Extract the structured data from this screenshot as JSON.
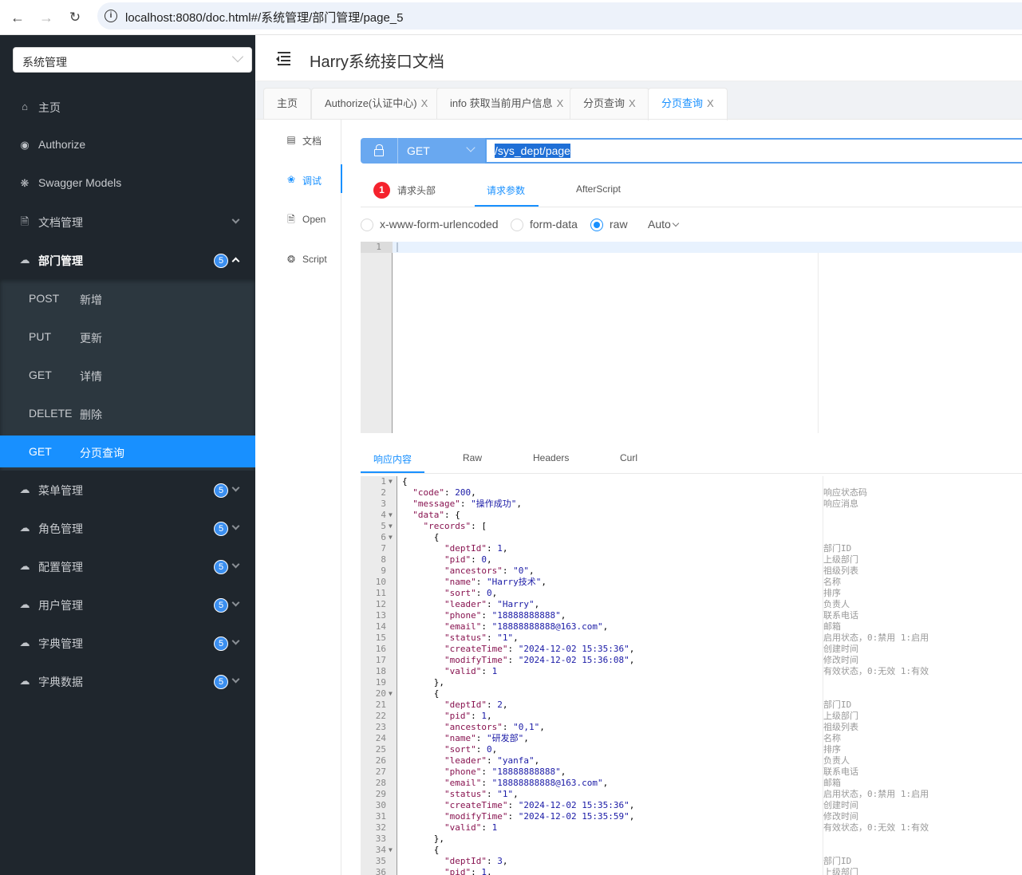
{
  "browser": {
    "url": "localhost:8080/doc.html#/系统管理/部门管理/page_5",
    "back_icon": "arrow-left-icon",
    "forward_icon": "arrow-right-icon",
    "reload_icon": "reload-icon"
  },
  "sidebar": {
    "group_select": "系统管理",
    "items": [
      {
        "label": "主页",
        "icon": "home-icon"
      },
      {
        "label": "Authorize",
        "icon": "lock-icon"
      },
      {
        "label": "Swagger Models",
        "icon": "cube-icon"
      },
      {
        "label": "文档管理",
        "icon": "doc-gear-icon"
      },
      {
        "label": "部门管理",
        "icon": "cloud-icon",
        "badge": "5"
      },
      {
        "label": "菜单管理",
        "icon": "cloud-icon",
        "badge": "5"
      },
      {
        "label": "角色管理",
        "icon": "cloud-icon",
        "badge": "5"
      },
      {
        "label": "配置管理",
        "icon": "cloud-icon",
        "badge": "5"
      },
      {
        "label": "用户管理",
        "icon": "cloud-icon",
        "badge": "5"
      },
      {
        "label": "字典管理",
        "icon": "cloud-icon",
        "badge": "5"
      },
      {
        "label": "字典数据",
        "icon": "cloud-icon",
        "badge": "5"
      }
    ],
    "submenu": [
      {
        "method": "POST",
        "name": "新增"
      },
      {
        "method": "PUT",
        "name": "更新"
      },
      {
        "method": "GET",
        "name": "详情"
      },
      {
        "method": "DELETE",
        "name": "删除"
      },
      {
        "method": "GET",
        "name": "分页查询"
      }
    ]
  },
  "header": {
    "title": "Harry系统接口文档"
  },
  "tabs": [
    {
      "label": "主页",
      "closable": false
    },
    {
      "label": "Authorize(认证中心)",
      "closable": true
    },
    {
      "label": "info 获取当前用户信息",
      "closable": true
    },
    {
      "label": "分页查询",
      "closable": true
    },
    {
      "label": "分页查询",
      "closable": true,
      "active": true
    }
  ],
  "close_glyph": "X",
  "subnav": [
    {
      "label": "文档",
      "icon": "document-icon"
    },
    {
      "label": "调试",
      "icon": "bug-icon"
    },
    {
      "label": "Open",
      "icon": "file-icon"
    },
    {
      "label": "Script",
      "icon": "script-icon"
    }
  ],
  "request": {
    "method": "GET",
    "url": "/sys_dept/page",
    "param_tabs": [
      "请求头部",
      "请求参数",
      "AfterScript"
    ],
    "header_error_count": "1",
    "body_types": [
      "x-www-form-urlencoded",
      "form-data",
      "raw"
    ],
    "selected_body_type": "raw",
    "raw_format": "Auto",
    "editor_line": "1"
  },
  "response": {
    "tabs": [
      "响应内容",
      "Raw",
      "Headers",
      "Curl"
    ],
    "lines": [
      {
        "n": "1",
        "fold": true,
        "code": "{",
        "cmt": ""
      },
      {
        "n": "2",
        "code": "  <k>\"code\"</k>: <n>200</n>,",
        "cmt": "响应状态码"
      },
      {
        "n": "3",
        "code": "  <k>\"message\"</k>: <s>\"操作成功\"</s>,",
        "cmt": "响应消息"
      },
      {
        "n": "4",
        "fold": true,
        "code": "  <k>\"data\"</k>: {",
        "cmt": ""
      },
      {
        "n": "5",
        "fold": true,
        "code": "    <k>\"records\"</k>: [",
        "cmt": ""
      },
      {
        "n": "6",
        "fold": true,
        "code": "      {",
        "cmt": ""
      },
      {
        "n": "7",
        "code": "        <k>\"deptId\"</k>: <n>1</n>,",
        "cmt": "部门ID"
      },
      {
        "n": "8",
        "code": "        <k>\"pid\"</k>: <n>0</n>,",
        "cmt": "上级部门"
      },
      {
        "n": "9",
        "code": "        <k>\"ancestors\"</k>: <s>\"0\"</s>,",
        "cmt": "祖级列表"
      },
      {
        "n": "10",
        "code": "        <k>\"name\"</k>: <s>\"Harry技术\"</s>,",
        "cmt": "名称"
      },
      {
        "n": "11",
        "code": "        <k>\"sort\"</k>: <n>0</n>,",
        "cmt": "排序"
      },
      {
        "n": "12",
        "code": "        <k>\"leader\"</k>: <s>\"Harry\"</s>,",
        "cmt": "负责人"
      },
      {
        "n": "13",
        "code": "        <k>\"phone\"</k>: <s>\"18888888888\"</s>,",
        "cmt": "联系电话"
      },
      {
        "n": "14",
        "code": "        <k>\"email\"</k>: <s>\"18888888888@163.com\"</s>,",
        "cmt": "邮箱"
      },
      {
        "n": "15",
        "code": "        <k>\"status\"</k>: <s>\"1\"</s>,",
        "cmt": "启用状态，0:禁用 1:启用"
      },
      {
        "n": "16",
        "code": "        <k>\"createTime\"</k>: <s>\"2024-12-02 15:35:36\"</s>,",
        "cmt": "创建时间"
      },
      {
        "n": "17",
        "code": "        <k>\"modifyTime\"</k>: <s>\"2024-12-02 15:36:08\"</s>,",
        "cmt": "修改时间"
      },
      {
        "n": "18",
        "code": "        <k>\"valid\"</k>: <n>1</n>",
        "cmt": "有效状态，0:无效 1:有效"
      },
      {
        "n": "19",
        "code": "      },",
        "cmt": ""
      },
      {
        "n": "20",
        "fold": true,
        "code": "      {",
        "cmt": ""
      },
      {
        "n": "21",
        "code": "        <k>\"deptId\"</k>: <n>2</n>,",
        "cmt": "部门ID"
      },
      {
        "n": "22",
        "code": "        <k>\"pid\"</k>: <n>1</n>,",
        "cmt": "上级部门"
      },
      {
        "n": "23",
        "code": "        <k>\"ancestors\"</k>: <s>\"0,1\"</s>,",
        "cmt": "祖级列表"
      },
      {
        "n": "24",
        "code": "        <k>\"name\"</k>: <s>\"研发部\"</s>,",
        "cmt": "名称"
      },
      {
        "n": "25",
        "code": "        <k>\"sort\"</k>: <n>0</n>,",
        "cmt": "排序"
      },
      {
        "n": "26",
        "code": "        <k>\"leader\"</k>: <s>\"yanfa\"</s>,",
        "cmt": "负责人"
      },
      {
        "n": "27",
        "code": "        <k>\"phone\"</k>: <s>\"18888888888\"</s>,",
        "cmt": "联系电话"
      },
      {
        "n": "28",
        "code": "        <k>\"email\"</k>: <s>\"18888888888@163.com\"</s>,",
        "cmt": "邮箱"
      },
      {
        "n": "29",
        "code": "        <k>\"status\"</k>: <s>\"1\"</s>,",
        "cmt": "启用状态，0:禁用 1:启用"
      },
      {
        "n": "30",
        "code": "        <k>\"createTime\"</k>: <s>\"2024-12-02 15:35:36\"</s>,",
        "cmt": "创建时间"
      },
      {
        "n": "31",
        "code": "        <k>\"modifyTime\"</k>: <s>\"2024-12-02 15:35:59\"</s>,",
        "cmt": "修改时间"
      },
      {
        "n": "32",
        "code": "        <k>\"valid\"</k>: <n>1</n>",
        "cmt": "有效状态，0:无效 1:有效"
      },
      {
        "n": "33",
        "code": "      },",
        "cmt": ""
      },
      {
        "n": "34",
        "fold": true,
        "code": "      {",
        "cmt": ""
      },
      {
        "n": "35",
        "code": "        <k>\"deptId\"</k>: <n>3</n>,",
        "cmt": "部门ID"
      },
      {
        "n": "36",
        "code": "        <k>\"pid\"</k>: <n>1</n>,",
        "cmt": "上级部门"
      }
    ]
  },
  "colors": {
    "accent": "#1890ff",
    "sidebar_bg": "#1f262d",
    "submenu_bg": "#2c373f",
    "badge": "#3b8ff0",
    "error": "#f5222d"
  }
}
